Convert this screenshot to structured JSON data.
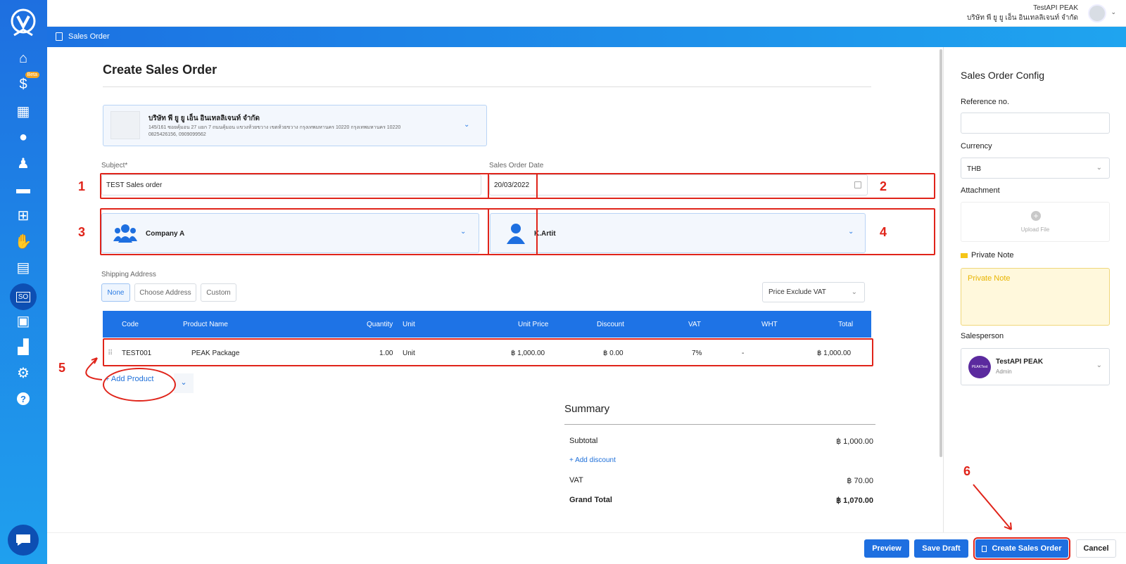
{
  "sidebar": {
    "beta_label": "Beta",
    "icons": [
      "home-icon",
      "finance-icon",
      "calendar-icon",
      "users-icon",
      "user-icon",
      "wallet-icon",
      "org-icon",
      "handshake-icon",
      "document-icon",
      "sales-order-icon",
      "box-icon",
      "chart-icon",
      "gear-icon",
      "help-icon"
    ]
  },
  "topbar": {
    "user_name": "TestAPI PEAK",
    "company": "บริษัท พี ยู ยู เอ็น อินเทลลิเจนท์ จำกัด"
  },
  "breadcrumb": {
    "title": "Sales Order"
  },
  "page": {
    "title": "Create Sales Order"
  },
  "company_card": {
    "name": "บริษัท พี ยู ยู เอ็น อินเทลลิเจนท์ จำกัด",
    "address": "145/161 ซอยคุ้มอน 27 แยก 7 ถนนคุ้มอน แขวงห้วยขวาง เขตห้วยขวาง กรุงเทพมหานคร 10220 กรุงเทพมหานคร 10220",
    "phones": "0825426156, 0909099562"
  },
  "form": {
    "subject_label": "Subject*",
    "subject_value": "TEST Sales order",
    "date_label": "Sales Order Date",
    "date_value": "20/03/2022",
    "contact_name": "Company A",
    "salesman_name": "K.Artit"
  },
  "shipping": {
    "label": "Shipping Address",
    "options": [
      "None",
      "Choose Address",
      "Custom"
    ],
    "price_mode": "Price Exclude VAT"
  },
  "table": {
    "headers": [
      "Code",
      "Product Name",
      "Quantity",
      "Unit",
      "Unit Price",
      "Discount",
      "VAT",
      "WHT",
      "Total"
    ],
    "row": {
      "code": "TEST001",
      "name": "PEAK Package",
      "qty": "1.00",
      "unit": "Unit",
      "price": "฿ 1,000.00",
      "discount": "฿ 0.00",
      "vat": "7%",
      "wht": "-",
      "total": "฿ 1,000.00"
    }
  },
  "add_product": "+ Add Product",
  "summary": {
    "title": "Summary",
    "subtotal_label": "Subtotal",
    "subtotal": "฿ 1,000.00",
    "add_discount": "+ Add discount",
    "vat_label": "VAT",
    "vat": "฿ 70.00",
    "grand_label": "Grand Total",
    "grand": "฿ 1,070.00"
  },
  "config": {
    "title": "Sales Order Config",
    "ref_label": "Reference no.",
    "currency_label": "Currency",
    "currency": "THB",
    "attachment_label": "Attachment",
    "upload": "Upload File",
    "note_label": "Private Note",
    "note_placeholder": "Private Note",
    "salesperson_label": "Salesperson",
    "sp_name": "TestAPI PEAK",
    "sp_role": "Admin",
    "sp_avatar": "PEAKTest"
  },
  "footer": {
    "preview": "Preview",
    "save_draft": "Save Draft",
    "create": "Create Sales Order",
    "cancel": "Cancel"
  },
  "annotations": [
    "1",
    "2",
    "3",
    "4",
    "5",
    "6"
  ]
}
